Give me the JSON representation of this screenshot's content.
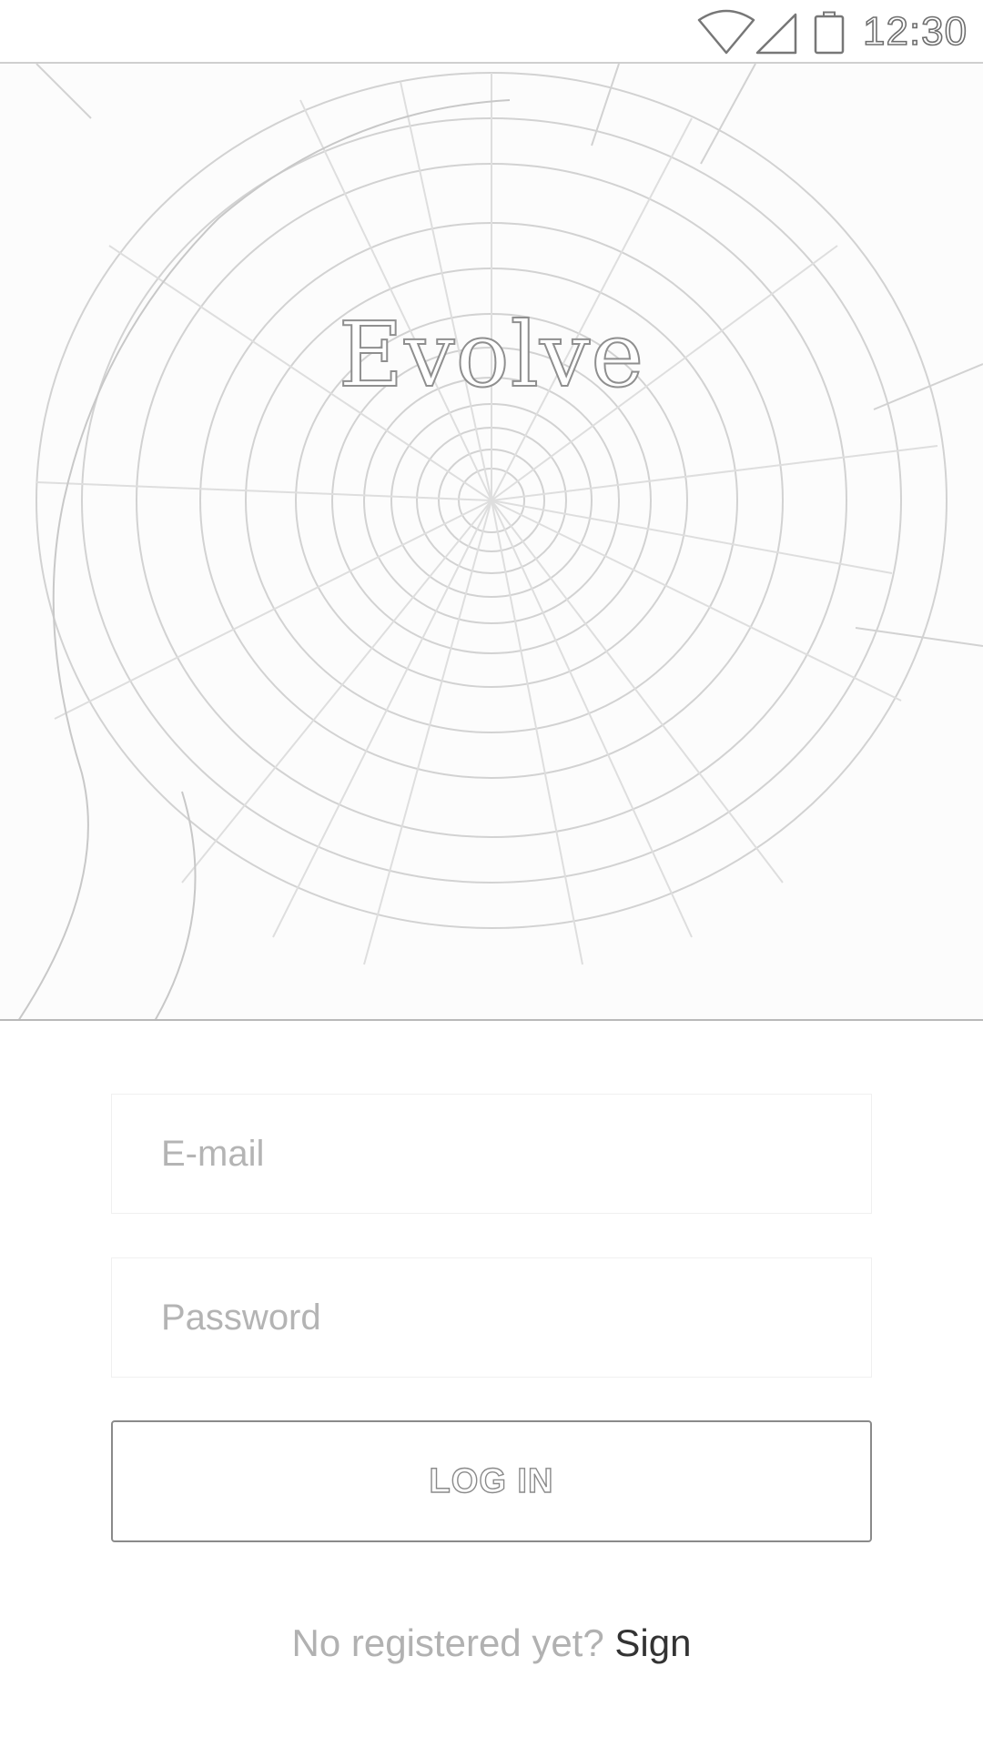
{
  "status_bar": {
    "time": "12:30",
    "icons": [
      "wifi-icon",
      "cellular-signal-icon",
      "battery-icon"
    ]
  },
  "hero": {
    "image": "spiral-staircase-image",
    "title": "Evolve"
  },
  "form": {
    "email": {
      "placeholder": "E-mail",
      "value": ""
    },
    "password": {
      "placeholder": "Password",
      "value": ""
    },
    "login_label": "LOG IN"
  },
  "signup": {
    "prompt": "No registered yet?",
    "link_label": "Sign"
  },
  "colors": {
    "background": "#ffffff",
    "placeholder_text": "#b4b4b4",
    "button_border": "#8a8a8a",
    "link_text": "#333333",
    "divider": "#b9b9b9"
  }
}
